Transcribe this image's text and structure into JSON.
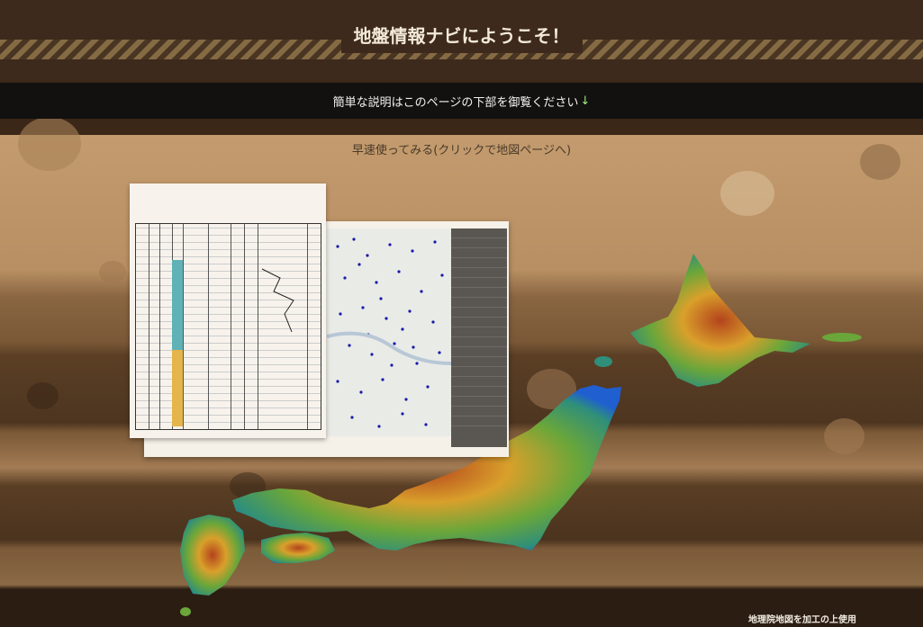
{
  "header": {
    "title": "地盤情報ナビにようこそ！"
  },
  "notice": {
    "text": "簡単な説明はこのページの下部を御覧ください",
    "arrow": "↓"
  },
  "main": {
    "map_link_text": "早速使ってみる(クリックで地図ページへ)"
  },
  "footer": {
    "credit": "地理院地図を加工の上使用"
  },
  "colors": {
    "header_bg": "#3d2a1c",
    "notice_bg": "#121110",
    "accent_arrow": "#9ef07a"
  }
}
